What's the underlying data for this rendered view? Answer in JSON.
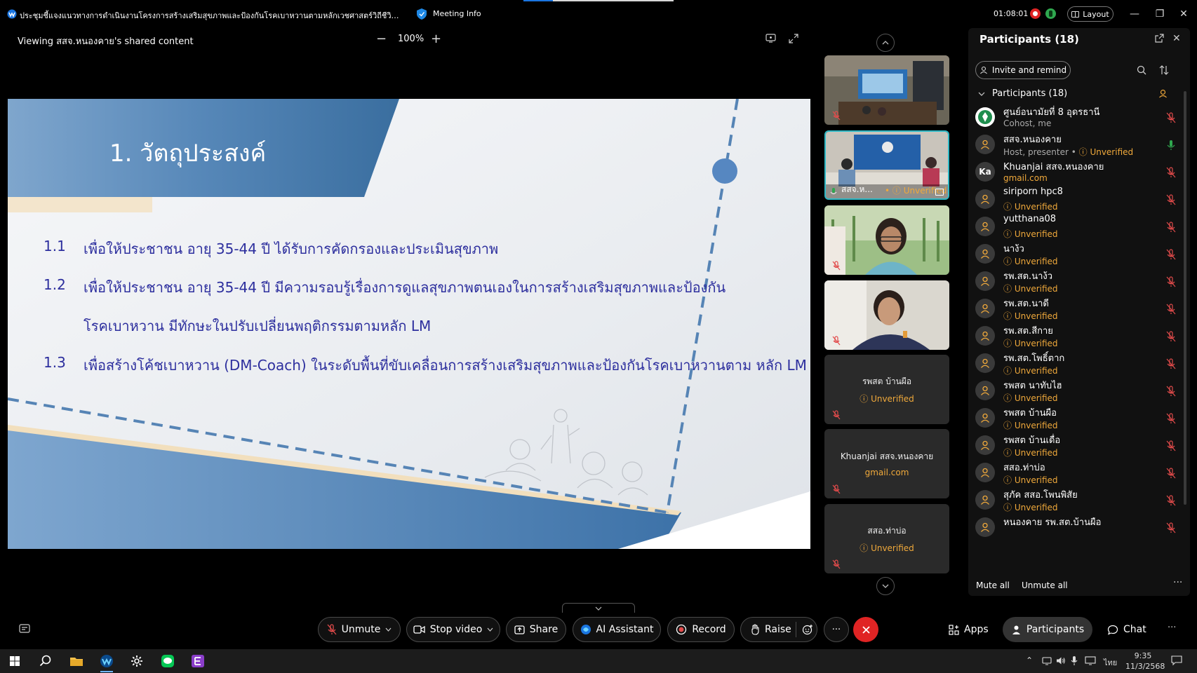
{
  "window": {
    "meeting_title": "ประชุมชี้แจงแนวทางการดำเนินงานโครงการสร้างเสริมสุขภาพและป้องกันโรคเบาหวานตามหลักเวชศาสตร์วิถีชีวิต (Lifesty...",
    "meeting_info": "Meeting Info",
    "timer": "01:08:01",
    "layout_label": "Layout"
  },
  "viewer": {
    "viewing_text": "Viewing สสจ.หนองคาย's shared content",
    "zoom": "100%",
    "zoom_out": "−",
    "zoom_in": "+"
  },
  "slide": {
    "title": "1. วัตถุประสงค์",
    "items": [
      {
        "num": "1.1",
        "text": "เพื่อให้ประชาชน อายุ 35-44 ปี ได้รับการคัดกรองและประเมินสุขภาพ"
      },
      {
        "num": "1.2",
        "text": "เพื่อให้ประชาชน อายุ 35-44 ปี มีความรอบรู้เรื่องการดูแลสุขภาพตนเองในการสร้างเสริมสุขภาพและป้องกัน",
        "cont": "โรคเบาหวาน มีทักษะในปรับเปลี่ยนพฤติกรรมตามหลัก LM"
      },
      {
        "num": "1.3",
        "text": "เพื่อสร้างโค้ชเบาหวาน (DM-Coach) ในระดับพื้นที่ขับเคลื่อนการสร้างเสริมสุขภาพและป้องกันโรคเบาหวานตาม หลัก LM"
      }
    ]
  },
  "video_tiles": {
    "active_name": "สสจ.ห...",
    "active_status": "Unverified",
    "name_tiles": [
      {
        "name": "รพสต บ้านผือ",
        "status": "Unverified"
      },
      {
        "name": "Khuanjai สสจ.หนองคาย",
        "status": "gmail.com"
      },
      {
        "name": "สสอ.ท่าบ่อ",
        "status": "Unverified"
      }
    ]
  },
  "participants_panel": {
    "header": "Participants (18)",
    "invite_label": "Invite and remind",
    "group_label": "Participants (18)",
    "list": [
      {
        "name": "ศูนย์อนามัยที่ 8 อุดรธานี",
        "sub": "Cohost, me",
        "sub_type": "role",
        "avatar": "logo",
        "mic": "off"
      },
      {
        "name": "สสจ.หนองคาย",
        "sub": "Host, presenter",
        "sub_extra": "Unverified",
        "sub_type": "role",
        "avatar": "person",
        "mic": "on"
      },
      {
        "name": "Khuanjai สสจ.หนองคาย",
        "sub": "gmail.com",
        "sub_type": "email",
        "avatar": "Ka",
        "mic": "off"
      },
      {
        "name": "siriporn hpc8",
        "sub": "Unverified",
        "sub_type": "unverified",
        "avatar": "person",
        "mic": "off"
      },
      {
        "name": "yutthana08",
        "sub": "Unverified",
        "sub_type": "unverified",
        "avatar": "person",
        "mic": "off"
      },
      {
        "name": "นาง้ว",
        "sub": "Unverified",
        "sub_type": "unverified",
        "avatar": "person",
        "mic": "off"
      },
      {
        "name": "รพ.สต.นาง้ว",
        "sub": "Unverified",
        "sub_type": "unverified",
        "avatar": "person",
        "mic": "off"
      },
      {
        "name": "รพ.สต.นาดี",
        "sub": "Unverified",
        "sub_type": "unverified",
        "avatar": "person",
        "mic": "off"
      },
      {
        "name": "รพ.สต.สีกาย",
        "sub": "Unverified",
        "sub_type": "unverified",
        "avatar": "person",
        "mic": "off"
      },
      {
        "name": "รพ.สต.โพธิ์ตาก",
        "sub": "Unverified",
        "sub_type": "unverified",
        "avatar": "person",
        "mic": "off"
      },
      {
        "name": "รพสต นาทับไฮ",
        "sub": "Unverified",
        "sub_type": "unverified",
        "avatar": "person",
        "mic": "off"
      },
      {
        "name": "รพสต บ้านผือ",
        "sub": "Unverified",
        "sub_type": "unverified",
        "avatar": "person",
        "mic": "off"
      },
      {
        "name": "รพสต บ้านเดื่อ",
        "sub": "Unverified",
        "sub_type": "unverified",
        "avatar": "person",
        "mic": "off"
      },
      {
        "name": "สสอ.ท่าบ่อ",
        "sub": "Unverified",
        "sub_type": "unverified",
        "avatar": "person",
        "mic": "off"
      },
      {
        "name": "สุภัค สสอ.โพนพิสัย",
        "sub": "Unverified",
        "sub_type": "unverified",
        "avatar": "person",
        "mic": "off"
      },
      {
        "name": "หนองคาย รพ.สต.บ้านผือ",
        "sub": "",
        "sub_type": "none",
        "avatar": "person",
        "mic": "off"
      }
    ],
    "mute_all": "Mute all",
    "unmute_all": "Unmute all"
  },
  "controls": {
    "unmute": "Unmute",
    "stop_video": "Stop video",
    "share": "Share",
    "ai_assistant": "AI Assistant",
    "record": "Record",
    "raise": "Raise",
    "apps": "Apps",
    "participants": "Participants",
    "chat": "Chat"
  },
  "taskbar": {
    "time": "9:35",
    "date": "11/3/2568",
    "lang": "ไทย"
  },
  "colors": {
    "unverified": "#f0a93b",
    "slide_text": "#2d2f9e",
    "end_call": "#e02424",
    "active_tile_border": "#2fb9c6"
  }
}
